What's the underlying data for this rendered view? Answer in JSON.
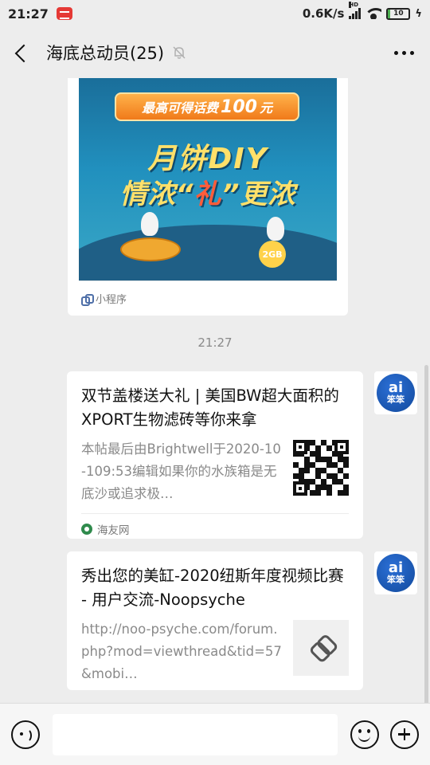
{
  "status_bar": {
    "time": "21:27",
    "network_speed": "0.6K/s",
    "signal_label": "HD",
    "battery_level": "10",
    "battery_fraction": 0.1
  },
  "nav": {
    "title": "海底总动员(25)",
    "icons": [
      "back-icon",
      "mute-bell-icon",
      "more-icon"
    ]
  },
  "mini_program": {
    "banner_text": "最高可得话费",
    "banner_amount": "100",
    "banner_unit": "元",
    "headline_1": "月饼DIY",
    "headline_2_a": "情浓“",
    "headline_2_b": "礼",
    "headline_2_c": "”更浓",
    "coin_label": "2GB",
    "footer_label": "小程序"
  },
  "timestamp": "21:27",
  "messages": [
    {
      "title": "双节盖楼送大礼 | 美国BW超大面积的XPORT生物滤砖等你来拿",
      "description": "本帖最后由Brightwell于2020-10-109:53编辑如果你的水族箱是无底沙或追求极…",
      "source": "海友网",
      "thumb_icon": "qr-code-icon"
    },
    {
      "title": "秀出您的美缸-2020纽斯年度视频比赛 - 用户交流-Noopsyche",
      "description": "http://noo-psyche.com/forum.php?mod=viewthread&tid=57&mobi…",
      "thumb_icon": "link-icon"
    }
  ],
  "avatar": {
    "text_top": "ai",
    "text_bottom": "笨笨"
  },
  "input_bar": {
    "placeholder": "",
    "icons": [
      "voice-icon",
      "emoji-icon",
      "plus-icon"
    ]
  }
}
